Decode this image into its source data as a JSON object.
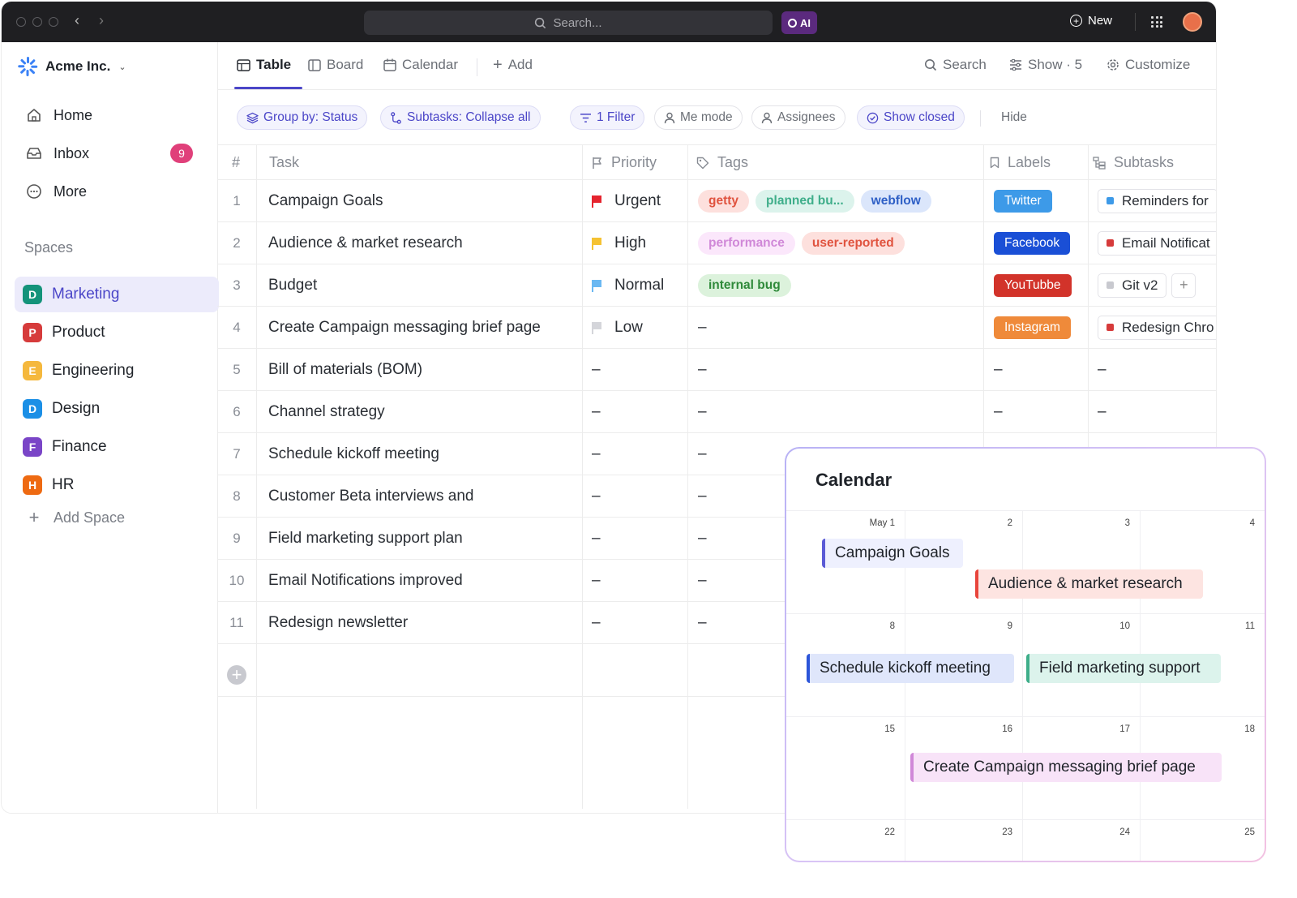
{
  "topbar": {
    "search_placeholder": "Search...",
    "ai_label": "AI",
    "new_label": "New"
  },
  "sidebar": {
    "workspace_name": "Acme Inc.",
    "nav": [
      {
        "label": "Home",
        "icon": "home-icon"
      },
      {
        "label": "Inbox",
        "icon": "inbox-icon",
        "badge": "9"
      },
      {
        "label": "More",
        "icon": "more-icon"
      }
    ],
    "spaces_label": "Spaces",
    "spaces": [
      {
        "letter": "D",
        "label": "Marketing",
        "color": "#14937a",
        "active": true
      },
      {
        "letter": "P",
        "label": "Product",
        "color": "#d63b3b"
      },
      {
        "letter": "E",
        "label": "Engineering",
        "color": "#f5b83d"
      },
      {
        "letter": "D",
        "label": "Design",
        "color": "#1b8fe6"
      },
      {
        "letter": "F",
        "label": "Finance",
        "color": "#7a45c7"
      },
      {
        "letter": "H",
        "label": "HR",
        "color": "#ee6a12"
      }
    ],
    "add_space_label": "Add Space"
  },
  "views": {
    "tabs": [
      "Table",
      "Board",
      "Calendar"
    ],
    "add_label": "Add",
    "search_label": "Search",
    "show_label": "Show · 5",
    "customize_label": "Customize"
  },
  "filters": {
    "group_by": "Group by: Status",
    "subtasks": "Subtasks: Collapse all",
    "filter": "1 Filter",
    "me_mode": "Me mode",
    "assignees": "Assignees",
    "show_closed": "Show closed",
    "hide": "Hide"
  },
  "table": {
    "headers": {
      "num": "#",
      "task": "Task",
      "priority": "Priority",
      "tags": "Tags",
      "labels": "Labels",
      "subtasks": "Subtasks"
    },
    "empty": "–",
    "rows": [
      {
        "num": "1",
        "task": "Campaign Goals",
        "priority": "Urgent",
        "priority_color": "#e5242e",
        "tags": [
          {
            "text": "getty",
            "bg": "#fde0dd",
            "fg": "#e0533f"
          },
          {
            "text": "planned bu...",
            "bg": "#dcf3ec",
            "fg": "#3fae8a"
          },
          {
            "text": "webflow",
            "bg": "#dbe6fb",
            "fg": "#2e5fc6"
          }
        ],
        "label": {
          "text": "Twitter",
          "bg": "#3d9ae8"
        },
        "subtask": {
          "text": "Reminders for",
          "color": "#3d9ae8"
        }
      },
      {
        "num": "2",
        "task": "Audience & market research",
        "priority": "High",
        "priority_color": "#f5c232",
        "tags": [
          {
            "text": "performance",
            "bg": "#fbe7fb",
            "fg": "#d088d8"
          },
          {
            "text": "user-reported",
            "bg": "#fde0dd",
            "fg": "#e0533f"
          }
        ],
        "label": {
          "text": "Facebook",
          "bg": "#1a4fd6"
        },
        "subtask": {
          "text": "Email Notificat",
          "color": "#d63b3b"
        }
      },
      {
        "num": "3",
        "task": "Budget",
        "priority": "Normal",
        "priority_color": "#6ab8f2",
        "tags": [
          {
            "text": "internal bug",
            "bg": "#dcf2dc",
            "fg": "#2f8a3a"
          }
        ],
        "label": {
          "text": "YouTubbe",
          "bg": "#d2332a"
        },
        "subtask": {
          "text": "Git v2",
          "color": "#c8c9cf"
        },
        "subtask_add": "+"
      },
      {
        "num": "4",
        "task": "Create Campaign messaging brief page",
        "priority": "Low",
        "priority_color": "#d4d5da",
        "tags": [],
        "label": {
          "text": "Instagram",
          "bg": "#ef8a3a"
        },
        "subtask": {
          "text": "Redesign Chro",
          "color": "#d63b3b"
        }
      },
      {
        "num": "5",
        "task": "Bill of materials (BOM)"
      },
      {
        "num": "6",
        "task": "Channel strategy"
      },
      {
        "num": "7",
        "task": "Schedule kickoff meeting"
      },
      {
        "num": "8",
        "task": "Customer Beta interviews and"
      },
      {
        "num": "9",
        "task": "Field marketing support plan"
      },
      {
        "num": "10",
        "task": "Email Notifications improved"
      },
      {
        "num": "11",
        "task": "Redesign newsletter"
      }
    ]
  },
  "calendar": {
    "title": "Calendar",
    "weeks": [
      [
        "May 1",
        "2",
        "3",
        "4"
      ],
      [
        "8",
        "9",
        "10",
        "11"
      ],
      [
        "15",
        "16",
        "17",
        "18"
      ],
      [
        "22",
        "23",
        "24",
        "25"
      ]
    ],
    "events": [
      {
        "text": "Campaign Goals",
        "bg": "#eef0fe",
        "bar": "#5b5bd6"
      },
      {
        "text": "Audience & market research",
        "bg": "#fde4e1",
        "bar": "#e8453c"
      },
      {
        "text": "Schedule kickoff meeting",
        "bg": "#dfe6fb",
        "bar": "#2c55d9"
      },
      {
        "text": "Field marketing support",
        "bg": "#dcf3ec",
        "bar": "#3fae8a"
      },
      {
        "text": "Create Campaign messaging brief page",
        "bg": "#f8e3f8",
        "bar": "#d088d8"
      }
    ]
  }
}
